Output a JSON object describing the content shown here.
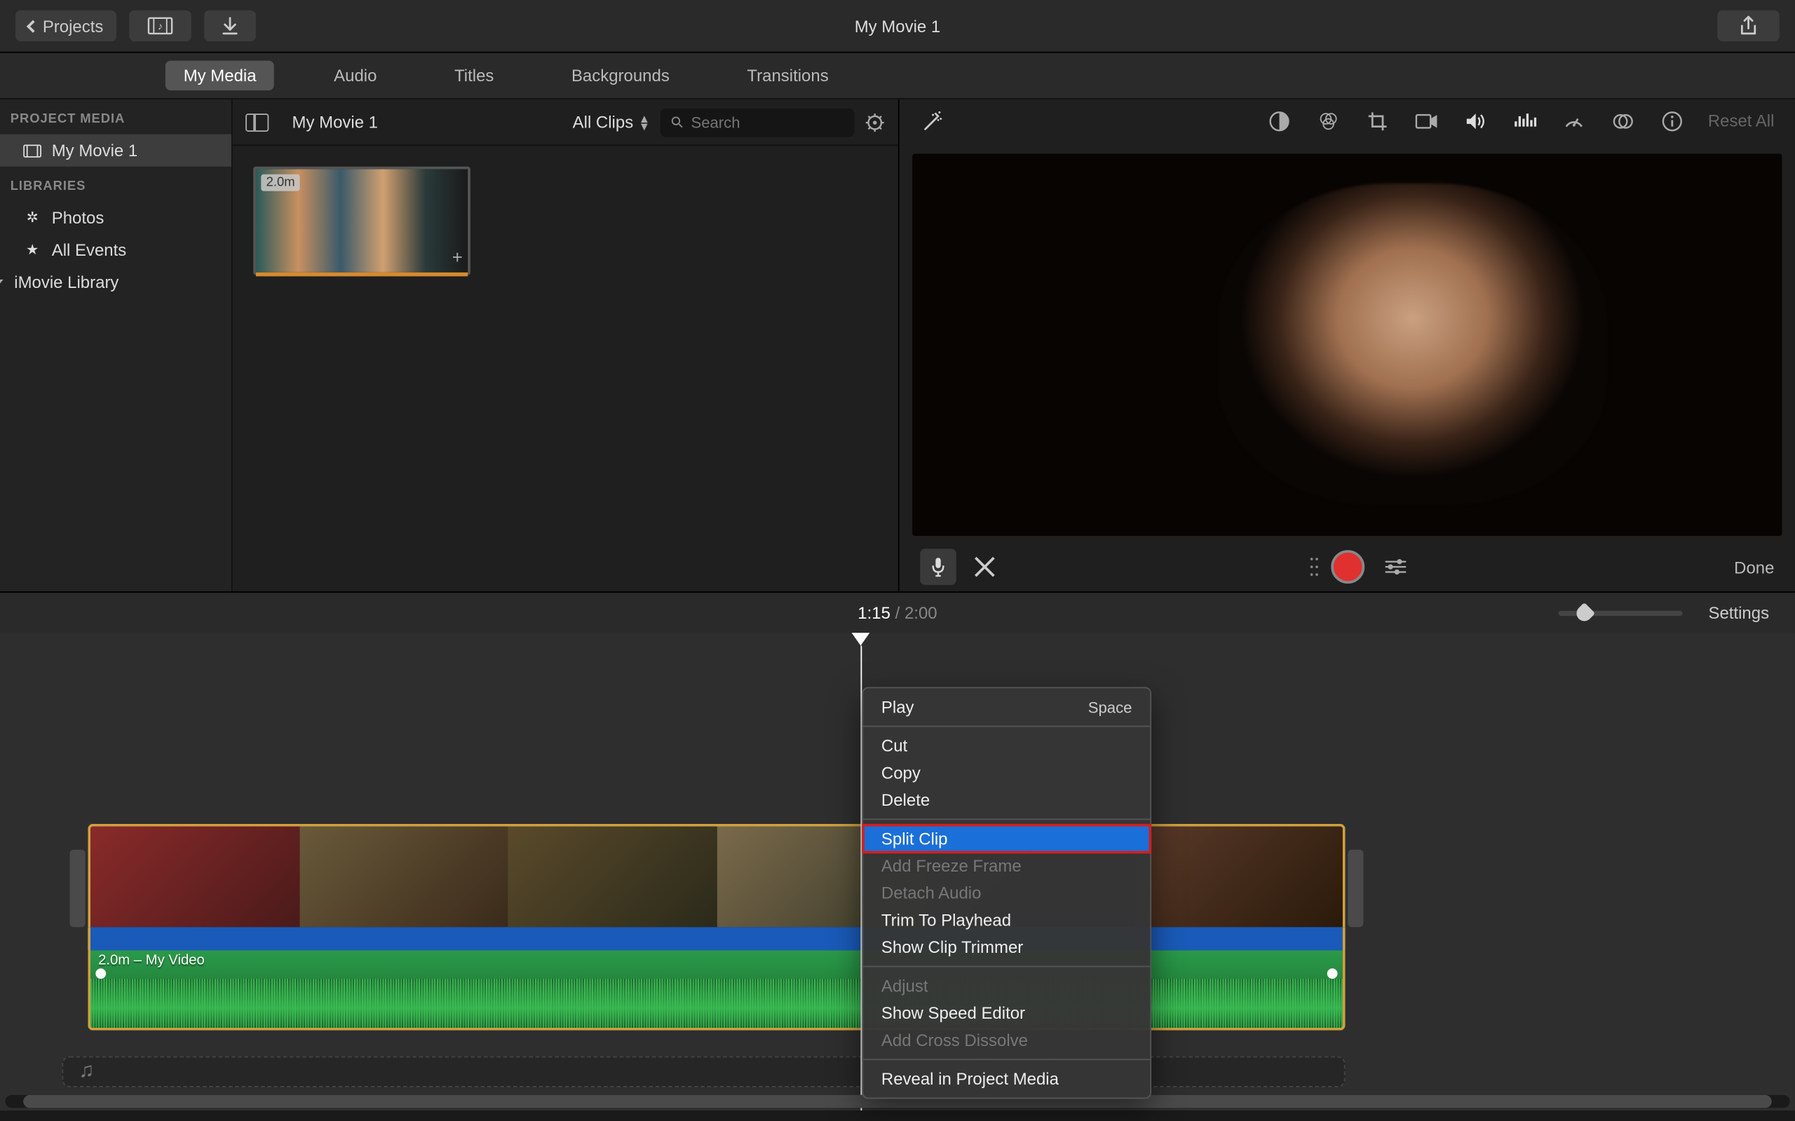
{
  "toolbar": {
    "projects_label": "Projects",
    "title": "My Movie 1"
  },
  "tabs": {
    "my_media": "My Media",
    "audio": "Audio",
    "titles": "Titles",
    "backgrounds": "Backgrounds",
    "transitions": "Transitions"
  },
  "sidebar": {
    "project_media_header": "PROJECT MEDIA",
    "project_name": "My Movie 1",
    "libraries_header": "LIBRARIES",
    "photos": "Photos",
    "all_events": "All Events",
    "imovie_library": "iMovie Library"
  },
  "media_panel": {
    "title": "My Movie 1",
    "filter": "All Clips",
    "search_placeholder": "Search",
    "clip_duration": "2.0m"
  },
  "preview": {
    "reset_all": "Reset All",
    "done": "Done"
  },
  "timeline_header": {
    "current": "1:15",
    "separator": "/",
    "duration": "2:00",
    "settings": "Settings"
  },
  "timeline": {
    "audio_label": "2.0m – My Video"
  },
  "context_menu": {
    "play": "Play",
    "play_shortcut": "Space",
    "cut": "Cut",
    "copy": "Copy",
    "delete": "Delete",
    "split_clip": "Split Clip",
    "add_freeze_frame": "Add Freeze Frame",
    "detach_audio": "Detach Audio",
    "trim_to_playhead": "Trim To Playhead",
    "show_clip_trimmer": "Show Clip Trimmer",
    "adjust": "Adjust",
    "show_speed_editor": "Show Speed Editor",
    "add_cross_dissolve": "Add Cross Dissolve",
    "reveal_in_project_media": "Reveal in Project Media"
  }
}
